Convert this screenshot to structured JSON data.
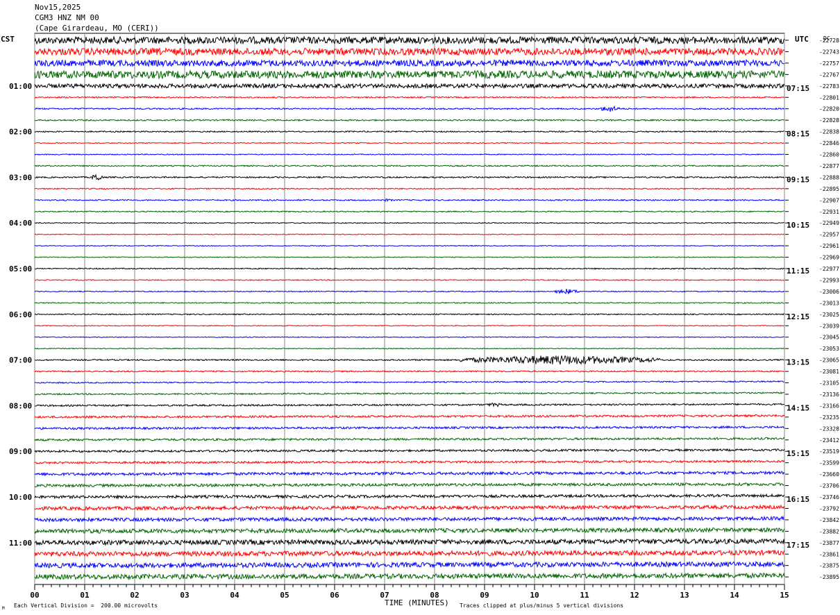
{
  "header": {
    "date": "Nov15,2025",
    "station": "CGM3 HNZ NM 00",
    "location": "(Cape Girardeau, MO (CERI))"
  },
  "labels": {
    "left_tz": "CST",
    "right_tz": "UTC",
    "dc": "DC",
    "corner_mark": "M",
    "xlabel": "TIME (MINUTES)",
    "scale_note": "Each Vertical Division =  200.00 microvolts",
    "clip_note": "Traces clipped at plus/minus 5 vertical divisions"
  },
  "chart_data": {
    "type": "line",
    "title": "CGM3 HNZ NM 00",
    "xlabel": "TIME (MINUTES)",
    "xlim": [
      0,
      15
    ],
    "x_ticks": [
      "00",
      "01",
      "02",
      "03",
      "04",
      "05",
      "06",
      "07",
      "08",
      "09",
      "10",
      "11",
      "12",
      "13",
      "14",
      "15"
    ],
    "colors": [
      "#000000",
      "#ff0000",
      "#0000ff",
      "#006400"
    ],
    "left_hour_labels": [
      "01:00",
      "02:00",
      "03:00",
      "04:00",
      "05:00",
      "06:00",
      "07:00",
      "08:00",
      "09:00",
      "10:00",
      "11:00"
    ],
    "right_hour_labels": [
      "07:15",
      "08:15",
      "09:15",
      "10:15",
      "11:15",
      "12:15",
      "13:15",
      "14:15",
      "15:15",
      "16:15",
      "17:15"
    ],
    "dc_offsets": [
      -22728,
      -22743,
      -22757,
      -22767,
      -22783,
      -22801,
      -22820,
      -22828,
      -22838,
      -22846,
      -22860,
      -22877,
      -22888,
      -22895,
      -22907,
      -22931,
      -22949,
      -22957,
      -22961,
      -22969,
      -22977,
      -22993,
      -23006,
      -23013,
      -23025,
      -23039,
      -23045,
      -23053,
      -23065,
      -23081,
      -23105,
      -23136,
      -23166,
      -23235,
      -23328,
      -23412,
      -23519,
      -23599,
      -23660,
      -23706,
      -23746,
      -23792,
      -23842,
      -23882,
      -23877,
      -23861,
      -23875,
      -23895
    ],
    "noise_levels": [
      5,
      5,
      4.5,
      5.5,
      3,
      1,
      1,
      1,
      0.9,
      0.7,
      0.7,
      0.9,
      1,
      0.8,
      0.9,
      0.8,
      0.7,
      0.6,
      0.6,
      0.6,
      0.8,
      0.7,
      0.7,
      0.8,
      0.8,
      0.6,
      0.6,
      0.6,
      1,
      1,
      0.9,
      1,
      1.2,
      1.5,
      1.5,
      1.5,
      1.5,
      1.5,
      2,
      2,
      2,
      2.5,
      2.5,
      3,
      3.5,
      3.5,
      3.5,
      3.5
    ],
    "events": [
      {
        "trace": 0,
        "start_min": 2.3,
        "end_min": 4.2,
        "amp": 2
      },
      {
        "trace": 6,
        "start_min": 11.3,
        "end_min": 11.7,
        "amp": 5
      },
      {
        "trace": 8,
        "start_min": 0.8,
        "end_min": 1.0,
        "amp": 1.5
      },
      {
        "trace": 12,
        "start_min": 1.15,
        "end_min": 1.35,
        "amp": 7
      },
      {
        "trace": 14,
        "start_min": 6.9,
        "end_min": 7.2,
        "amp": 2
      },
      {
        "trace": 22,
        "start_min": 10.4,
        "end_min": 10.9,
        "amp": 4
      },
      {
        "trace": 28,
        "start_min": 8.5,
        "end_min": 12.5,
        "amp": 7
      },
      {
        "trace": 32,
        "start_min": 9.0,
        "end_min": 9.4,
        "amp": 3
      },
      {
        "trace": 0,
        "start_min": 12.0,
        "end_min": 15.0,
        "amp": 2
      }
    ]
  }
}
